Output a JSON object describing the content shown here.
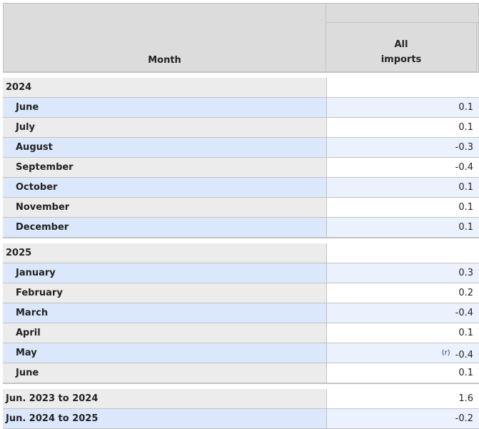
{
  "header": {
    "month_label": "Month",
    "col_line1": "All",
    "col_line2": "imports"
  },
  "groups": [
    {
      "year": "2024",
      "rows": [
        {
          "month": "June",
          "value": "0.1"
        },
        {
          "month": "July",
          "value": "0.1"
        },
        {
          "month": "August",
          "value": "-0.3"
        },
        {
          "month": "September",
          "value": "-0.4"
        },
        {
          "month": "October",
          "value": "0.1"
        },
        {
          "month": "November",
          "value": "0.1"
        },
        {
          "month": "December",
          "value": "0.1"
        }
      ]
    },
    {
      "year": "2025",
      "rows": [
        {
          "month": "January",
          "value": "0.3"
        },
        {
          "month": "February",
          "value": "0.2"
        },
        {
          "month": "March",
          "value": "-0.4"
        },
        {
          "month": "April",
          "value": "0.1"
        },
        {
          "month": "May",
          "value": "-0.4",
          "note": "(r)"
        },
        {
          "month": "June",
          "value": "0.1"
        }
      ]
    }
  ],
  "summary": [
    {
      "label": "Jun. 2023 to 2024",
      "value": "1.6"
    },
    {
      "label": "Jun. 2024 to 2025",
      "value": "-0.2"
    }
  ],
  "colors": {
    "header_bg": "#dcdcdc",
    "row_blue": "#dbe8fc",
    "row_grey": "#ececec",
    "note_color": "#1a3c99"
  }
}
